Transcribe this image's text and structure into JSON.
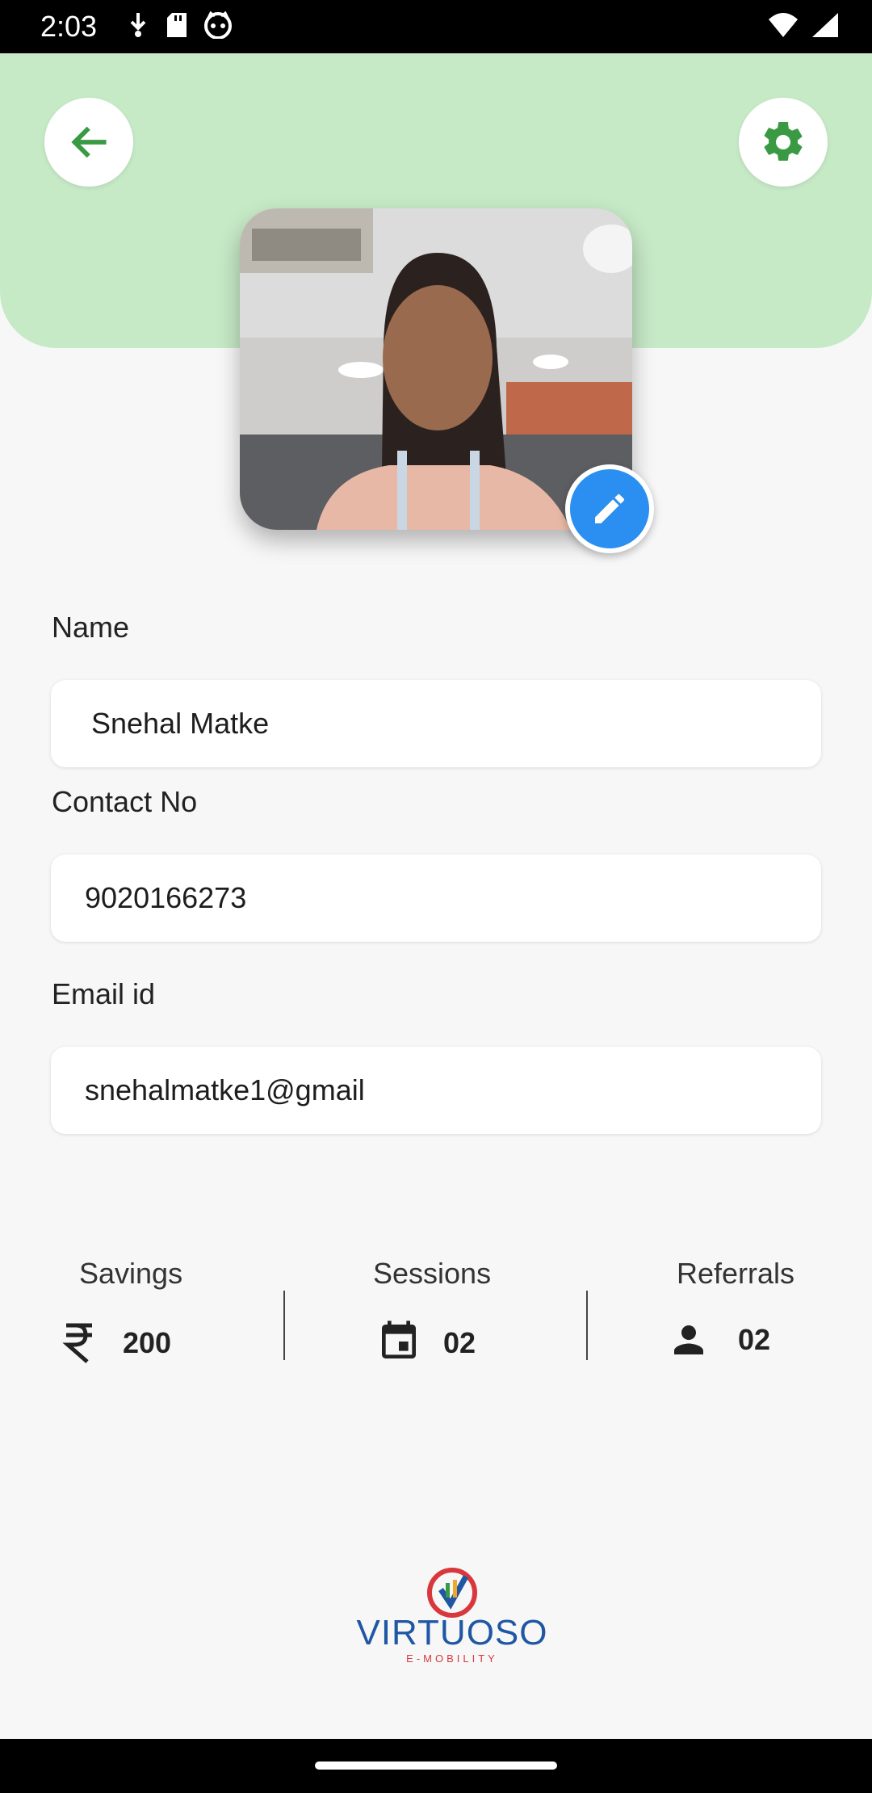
{
  "status_bar": {
    "time": "2:03"
  },
  "profile": {
    "name_label": "Name",
    "name_value": "Snehal Matke",
    "contact_label": "Contact No",
    "contact_value": "9020166273",
    "email_label": "Email id",
    "email_value": "snehalmatke1@gmail"
  },
  "stats": {
    "savings": {
      "title": "Savings",
      "value": "200",
      "icon": "rupee-icon"
    },
    "sessions": {
      "title": "Sessions",
      "value": "02",
      "icon": "calendar-icon"
    },
    "referrals": {
      "title": "Referrals",
      "value": "02",
      "icon": "person-icon"
    }
  },
  "logo": {
    "brand": "VIRTUOSO",
    "tagline": "E-MOBILITY"
  },
  "colors": {
    "header_bg": "#c6e9c6",
    "accent_green": "#3a9a44",
    "edit_blue": "#2a8ff0"
  }
}
